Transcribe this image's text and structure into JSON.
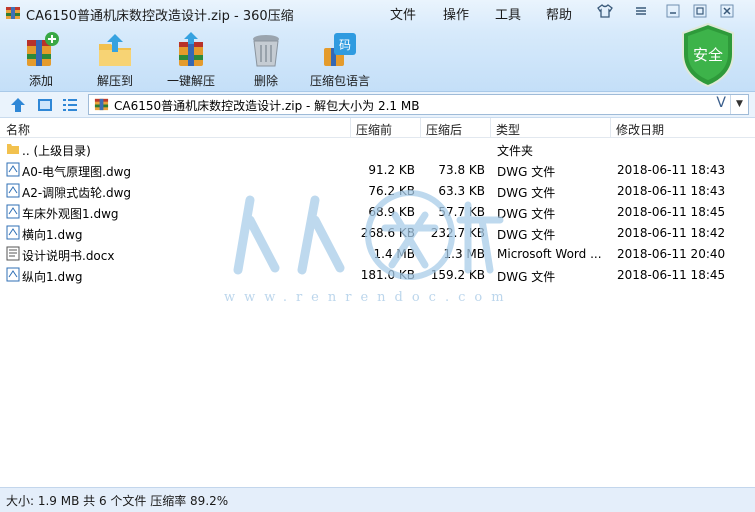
{
  "window": {
    "title": "CA6150普通机床数控改造设计.zip - 360压缩",
    "menu": [
      "文件",
      "操作",
      "工具",
      "帮助"
    ]
  },
  "toolbar": {
    "items": [
      {
        "label": "添加",
        "icon": "add-archive-icon"
      },
      {
        "label": "解压到",
        "icon": "extract-to-icon"
      },
      {
        "label": "一键解压",
        "icon": "one-click-extract-icon"
      },
      {
        "label": "删除",
        "icon": "delete-trash-icon"
      },
      {
        "label": "压缩包语言",
        "icon": "archive-language-icon"
      }
    ],
    "security_badge": "安全"
  },
  "address": {
    "path": "CA6150普通机床数控改造设计.zip - 解包大小为 2.1 MB",
    "vv": "V"
  },
  "columns": [
    "名称",
    "压缩前",
    "压缩后",
    "类型",
    "修改日期"
  ],
  "files": [
    {
      "name": ".. (上级目录)",
      "size": "",
      "packed": "",
      "type": "文件夹",
      "date": "",
      "icon": "folder-icon"
    },
    {
      "name": "A0-电气原理图.dwg",
      "size": "91.2 KB",
      "packed": "73.8 KB",
      "type": "DWG 文件",
      "date": "2018-06-11 18:43",
      "icon": "dwg-file-icon"
    },
    {
      "name": "A2-调隙式齿轮.dwg",
      "size": "76.2 KB",
      "packed": "63.3 KB",
      "type": "DWG 文件",
      "date": "2018-06-11 18:43",
      "icon": "dwg-file-icon"
    },
    {
      "name": "车床外观图1.dwg",
      "size": "68.9 KB",
      "packed": "57.7 KB",
      "type": "DWG 文件",
      "date": "2018-06-11 18:45",
      "icon": "dwg-file-icon"
    },
    {
      "name": "横向1.dwg",
      "size": "268.6 KB",
      "packed": "232.7 KB",
      "type": "DWG 文件",
      "date": "2018-06-11 18:42",
      "icon": "dwg-file-icon"
    },
    {
      "name": "设计说明书.docx",
      "size": "1.4 MB",
      "packed": "1.3 MB",
      "type": "Microsoft Word ...",
      "date": "2018-06-11 20:40",
      "icon": "docx-file-icon"
    },
    {
      "name": "纵向1.dwg",
      "size": "181.0 KB",
      "packed": "159.2 KB",
      "type": "DWG 文件",
      "date": "2018-06-11 18:45",
      "icon": "dwg-file-icon"
    }
  ],
  "watermark": {
    "text": "www.renrendoc.com"
  },
  "status": "大小: 1.9 MB 共 6 个文件 压缩率 89.2%"
}
